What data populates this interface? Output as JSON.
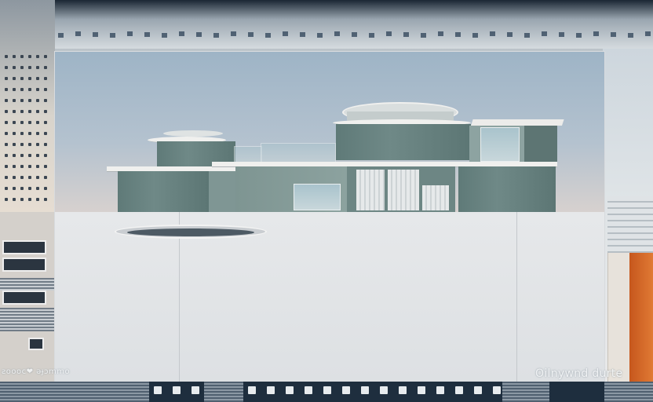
{
  "image": {
    "left_caption": "ƨoooᴄ❤ əɟɔmmo",
    "right_caption": "Oilnywnd durte"
  },
  "colors": {
    "sky": "#9eb4c6",
    "building_teal": "#6f8987",
    "wall": "#e6e8ea",
    "accent_orange": "#e07a34",
    "base_navy": "#1e2e3e"
  }
}
